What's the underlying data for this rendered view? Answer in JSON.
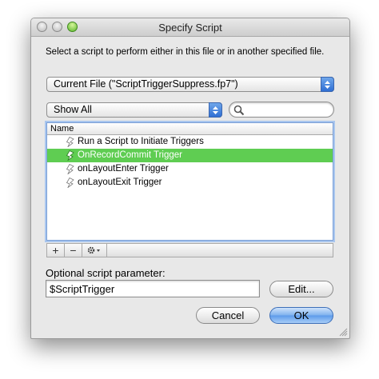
{
  "window": {
    "title": "Specify Script"
  },
  "prompt": "Select a script to perform either in this file or in another specified file.",
  "file_popup": {
    "value": "Current File (\"ScriptTriggerSuppress.fp7\")"
  },
  "filter_popup": {
    "value": "Show All"
  },
  "search": {
    "placeholder": ""
  },
  "list": {
    "column_header": "Name",
    "rows": [
      {
        "label": "Run a Script to Initiate Triggers",
        "selected": false
      },
      {
        "label": "OnRecordCommit Trigger",
        "selected": true
      },
      {
        "label": "onLayoutEnter Trigger",
        "selected": false
      },
      {
        "label": "onLayoutExit Trigger",
        "selected": false
      }
    ]
  },
  "list_footer": {
    "add": "+",
    "remove": "−"
  },
  "parameter": {
    "label": "Optional script parameter:",
    "value": "$ScriptTrigger"
  },
  "buttons": {
    "edit": "Edit...",
    "cancel": "Cancel",
    "ok": "OK"
  },
  "colors": {
    "selection": "#5fcd52",
    "default_button": "#5c9aea",
    "zoom_light": "#5bb72d"
  },
  "icons": [
    "script-icon",
    "search-icon",
    "gear-icon",
    "chevron-updown-icon"
  ]
}
